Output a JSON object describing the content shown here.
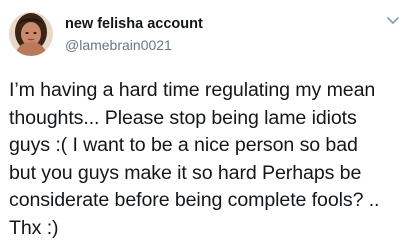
{
  "tweet": {
    "display_name": "new felisha account",
    "handle": "@lamebrain0021",
    "text": "I’m having a hard time regulating my mean\nthoughts... Please stop being lame idiots\nguys :( I want to be a nice person so bad\nbut you guys make it so hard Perhaps be\nconsiderate before being complete fools? ..\nThx :)"
  },
  "icons": {
    "avatar": "profile-photo",
    "menu": "chevron-down-icon"
  },
  "colors": {
    "text": "#14171a",
    "secondary_text": "#657786",
    "chevron": "#8899a6",
    "background": "#ffffff"
  }
}
